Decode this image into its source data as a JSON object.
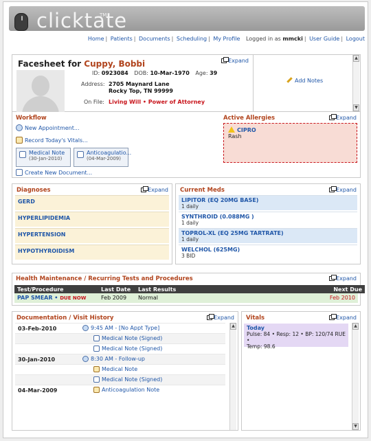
{
  "app": {
    "brand": "clicktate",
    "tm": "TM"
  },
  "nav": {
    "links": [
      "Home",
      "Patients",
      "Documents",
      "Scheduling",
      "My Profile"
    ],
    "logged_in_prefix": "Logged in as",
    "user": "mmcki",
    "right_links": [
      "User Guide",
      "Logout"
    ]
  },
  "facesheet": {
    "title_prefix": "Facesheet for",
    "patient_name": "Cuppy, Bobbi",
    "expand": "Expand",
    "id_label": "ID:",
    "id_value": "0923084",
    "dob_label": "DOB:",
    "dob_value": "10-Mar-1970",
    "age_label": "Age:",
    "age_value": "39",
    "address_label": "Address:",
    "address_line1": "2705 Maynard Lane",
    "address_line2": "Rocky Top, TN 99999",
    "onfile_label": "On File:",
    "onfile_items": [
      "Living Will",
      "Power of Attorney"
    ],
    "add_notes": "Add Notes"
  },
  "workflow": {
    "title": "Workflow",
    "links": [
      "New Appointment...",
      "Record Today's Vitals...",
      "Create New Document..."
    ],
    "cards": [
      {
        "title": "Medical Note",
        "date": "(30-Jan-2010)"
      },
      {
        "title": "Anticoagulatio...",
        "date": "(04-Mar-2009)"
      }
    ]
  },
  "allergies": {
    "title": "Active Allergies",
    "expand": "Expand",
    "items": [
      {
        "name": "CIPRO",
        "reaction": "Rash"
      }
    ]
  },
  "diagnoses": {
    "title": "Diagnoses",
    "expand": "Expand",
    "items": [
      "GERD",
      "HYPERLIPIDEMIA",
      "HYPERTENSION",
      "HYPOTHYROIDISM"
    ]
  },
  "meds": {
    "title": "Current Meds",
    "expand": "Expand",
    "items": [
      {
        "name": "LIPITOR (EQ 20MG BASE)",
        "sig": "1 daily"
      },
      {
        "name": "SYNTHROID (0.088MG )",
        "sig": "1 daily"
      },
      {
        "name": "TOPROL-XL (EQ 25MG TARTRATE)",
        "sig": "1 daily"
      },
      {
        "name": "WELCHOL (625MG)",
        "sig": "3 BID"
      }
    ]
  },
  "health_maintenance": {
    "title": "Health Maintenance / Recurring Tests and Procedures",
    "expand": "Expand",
    "columns": [
      "Test/Procedure",
      "Last Date",
      "Last Results",
      "Next Due"
    ],
    "rows": [
      {
        "test": "PAP SMEAR",
        "flag": "DUE NOW",
        "last_date": "Feb 2009",
        "result": "Normal",
        "next_due": "Feb 2010"
      }
    ]
  },
  "documentation": {
    "title": "Documentation / Visit History",
    "expand": "Expand",
    "rows": [
      {
        "date": "03-Feb-2010",
        "item": "9:45 AM - [No Appt Type]"
      },
      {
        "date": "",
        "item": "Medical Note (Signed)"
      },
      {
        "date": "",
        "item": "Medical Note (Signed)"
      },
      {
        "date": "30-Jan-2010",
        "item": "8:30 AM - Follow-up"
      },
      {
        "date": "",
        "item": "Medical Note"
      },
      {
        "date": "",
        "item": "Medical Note (Signed)"
      },
      {
        "date": "04-Mar-2009",
        "item": "Anticoagulation Note"
      }
    ]
  },
  "vitals": {
    "title": "Vitals",
    "expand": "Expand",
    "today_label": "Today",
    "line1": "Pulse: 84 • Resp: 12 • BP: 120/74 RUE •",
    "line2": "Temp: 98.6"
  },
  "colors": {
    "accent": "#b1441d",
    "link": "#1f56a8",
    "danger": "#c8141b"
  }
}
